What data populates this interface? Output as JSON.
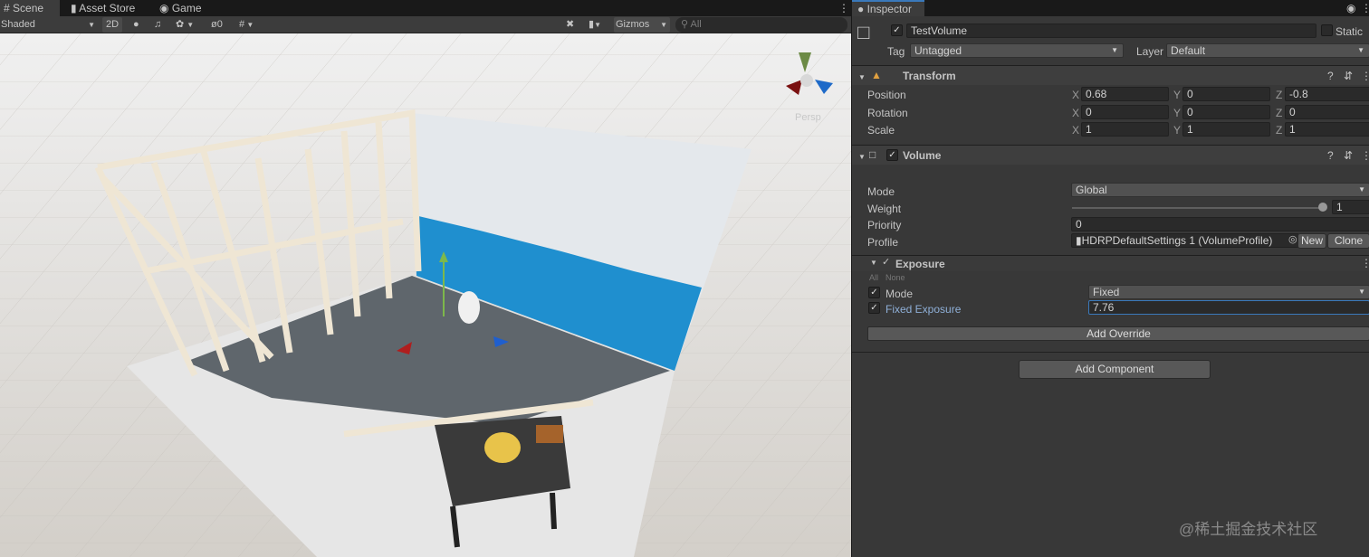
{
  "tabs": [
    {
      "icon": "hash-icon",
      "label": "Scene"
    },
    {
      "icon": "bag-icon",
      "label": "Asset Store"
    },
    {
      "icon": "gamepad-icon",
      "label": "Game"
    }
  ],
  "toolbar": {
    "shading": "Shaded",
    "mode_2d": "2D",
    "hidden_count": "0",
    "gizmos": "Gizmos",
    "search_placeholder": "All"
  },
  "scene": {
    "view_label": "Persp",
    "watermark": "@稀土掘金技术社区"
  },
  "inspector": {
    "tab": "Inspector",
    "object": {
      "name": "TestVolume",
      "active": true,
      "static_label": "Static",
      "tag_label": "Tag",
      "tag": "Untagged",
      "layer_label": "Layer",
      "layer": "Default"
    },
    "transform": {
      "title": "Transform",
      "rows": [
        {
          "label": "Position",
          "x": "0.68",
          "y": "0",
          "z": "-0.8"
        },
        {
          "label": "Rotation",
          "x": "0",
          "y": "0",
          "z": "0"
        },
        {
          "label": "Scale",
          "x": "1",
          "y": "1",
          "z": "1"
        }
      ],
      "axes": [
        "X",
        "Y",
        "Z"
      ]
    },
    "volume": {
      "title": "Volume",
      "mode_label": "Mode",
      "mode": "Global",
      "weight_label": "Weight",
      "weight": "1",
      "weight_fraction": 1.0,
      "priority_label": "Priority",
      "priority": "0",
      "profile_label": "Profile",
      "profile": "HDRPDefaultSettings 1 (VolumeProfile)",
      "new_label": "New",
      "clone_label": "Clone"
    },
    "exposure": {
      "title": "Exposure",
      "all_label": "All",
      "none_label": "None",
      "mode_label": "Mode",
      "mode": "Fixed",
      "fixed_label": "Fixed Exposure",
      "fixed_value": "7.76"
    },
    "add_override": "Add Override",
    "add_component": "Add Component"
  },
  "colors": {
    "accent": "#3a79bb",
    "wall_blue": "#1f8fcf"
  }
}
